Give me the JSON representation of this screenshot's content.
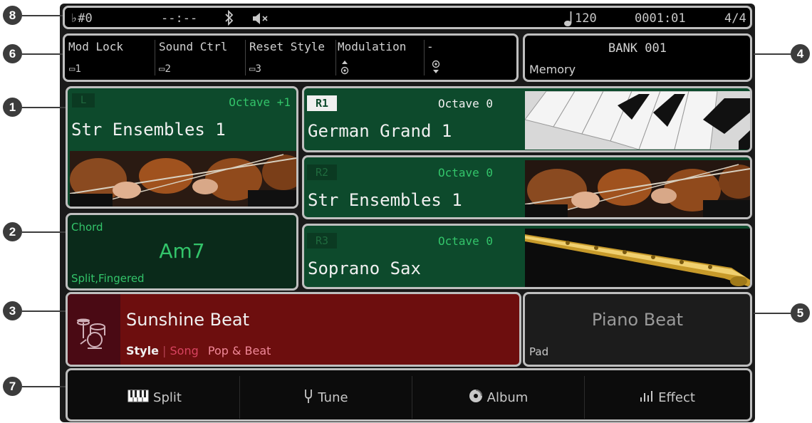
{
  "status": {
    "key": "♭#0",
    "time": "--:--",
    "bluetooth_icon": "bluetooth-icon",
    "mute_icon": "speaker-mute-icon",
    "tempo": "120",
    "measure": "0001:01",
    "signature": "4/4"
  },
  "top_strip": {
    "items": [
      {
        "label": "Mod Lock",
        "sub": "1"
      },
      {
        "label": "Sound Ctrl",
        "sub": "2"
      },
      {
        "label": "Reset Style",
        "sub": "3"
      },
      {
        "label": "Modulation",
        "sub": ""
      },
      {
        "label": "-",
        "sub": ""
      }
    ]
  },
  "bank": {
    "title": "BANK 001",
    "label": "Memory"
  },
  "voices": {
    "left": {
      "tag": "L",
      "octave": "Octave +1",
      "name": "Str Ensembles 1"
    },
    "r1": {
      "tag": "R1",
      "octave": "Octave 0",
      "name": "German Grand 1"
    },
    "r2": {
      "tag": "R2",
      "octave": "Octave 0",
      "name": "Str Ensembles 1"
    },
    "r3": {
      "tag": "R3",
      "octave": "Octave 0",
      "name": "Soprano Sax"
    }
  },
  "chord": {
    "label": "Chord",
    "name": "Am7",
    "mode": "Split,Fingered"
  },
  "style": {
    "name": "Sunshine Beat",
    "tab_style": "Style",
    "tab_sep": "|",
    "tab_song": "Song",
    "category": "Pop & Beat"
  },
  "pad": {
    "name": "Piano Beat",
    "label": "Pad"
  },
  "bottom": {
    "split": "Split",
    "tune": "Tune",
    "album": "Album",
    "effect": "Effect"
  },
  "callouts": [
    "8",
    "6",
    "4",
    "1",
    "2",
    "3",
    "5",
    "7"
  ],
  "colors": {
    "green_text": "#33c46a",
    "voice_bg": "#0d4a2c",
    "style_bg": "#6d0e0e",
    "song_pink": "#d8435f"
  }
}
